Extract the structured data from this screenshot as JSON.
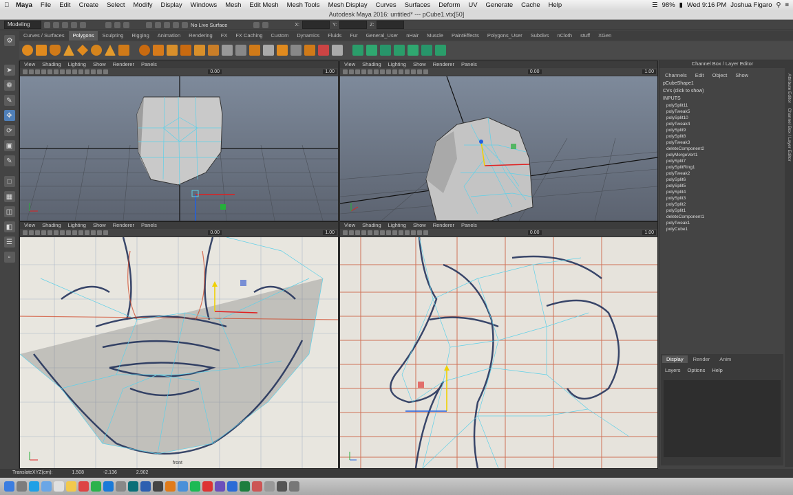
{
  "menubar": {
    "app": "Maya",
    "items": [
      "File",
      "Edit",
      "Create",
      "Select",
      "Modify",
      "Display",
      "Windows",
      "Mesh",
      "Edit Mesh",
      "Mesh Tools",
      "Mesh Display",
      "Curves",
      "Surfaces",
      "Deform",
      "UV",
      "Generate",
      "Cache",
      "Help"
    ],
    "battery": "98%",
    "clock": "Wed 9:16 PM",
    "user": "Joshua Figaro"
  },
  "window_title": "Autodesk Maya 2016: untitled*   ---   pCube1.vtx[50]",
  "statusline": {
    "mode": "Modeling",
    "live_surface": "No Live Surface",
    "coord_labels": [
      "X:",
      "Y:",
      "Z:"
    ]
  },
  "shelf_tabs": [
    "Curves / Surfaces",
    "Polygons",
    "Sculpting",
    "Rigging",
    "Animation",
    "Rendering",
    "FX",
    "FX Caching",
    "Custom",
    "Dynamics",
    "Fluids",
    "Fur",
    "General_User",
    "nHair",
    "Muscle",
    "PaintEffects",
    "Polygons_User",
    "Subdivs",
    "nCloth",
    "stuff",
    "XGen"
  ],
  "active_shelf": "Polygons",
  "viewport_menu": [
    "View",
    "Shading",
    "Lighting",
    "Show",
    "Renderer",
    "Panels"
  ],
  "viewport_values": {
    "near": "0.00",
    "far": "1.00"
  },
  "viewports": [
    {
      "id": "perspective-top-left",
      "label": ""
    },
    {
      "id": "perspective-top-right",
      "label": ""
    },
    {
      "id": "front-bottom-left",
      "label": "front"
    },
    {
      "id": "side-bottom-right",
      "label": ""
    }
  ],
  "channel_box": {
    "title": "Channel Box / Layer Editor",
    "menu": [
      "Channels",
      "Edit",
      "Object",
      "Show"
    ],
    "object": "pCubeShape1",
    "cvs": "CVs (click to show)",
    "inputs_label": "INPUTS",
    "inputs": [
      "polySplit11",
      "polyTweak5",
      "polySplit10",
      "polyTweak4",
      "polySplit9",
      "polySplit8",
      "polyTweak3",
      "deleteComponent2",
      "polyMergeVert1",
      "polySplit7",
      "polySplitRing1",
      "polyTweak2",
      "polySplit6",
      "polySplit5",
      "polySplit4",
      "polySplit3",
      "polySplit2",
      "polySplit1",
      "deleteComponent1",
      "polyTweak1",
      "polyCube1"
    ]
  },
  "layer_editor": {
    "tabs": [
      "Display",
      "Render",
      "Anim"
    ],
    "active_tab": "Display",
    "menu": [
      "Layers",
      "Options",
      "Help"
    ]
  },
  "right_strip": [
    "Attribute Editor",
    "Channel Box / Layer Editor"
  ],
  "helpline": {
    "label": "TranslateXYZ(cm):",
    "x": "1.508",
    "y": "-2.136",
    "z": "2.902"
  },
  "colors": {
    "wire": "#5fd0e8",
    "manip_x": "#e02020",
    "manip_y": "#f0d000",
    "manip_z": "#2060e0",
    "mesh": "#b8b8b8",
    "sketch_ink": "#1a2a55",
    "paper": "#e8e6df"
  }
}
